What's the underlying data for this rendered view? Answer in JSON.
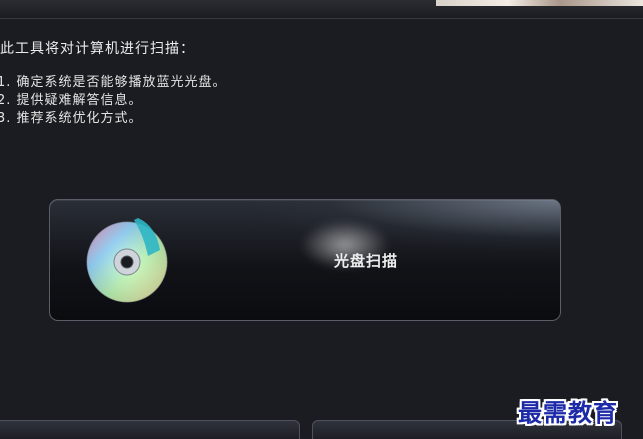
{
  "intro_text": "此工具将对计算机进行扫描：",
  "items": [
    {
      "num": "1.",
      "text": "确定系统是否能够播放蓝光光盘。"
    },
    {
      "num": "2.",
      "text": "提供疑难解答信息。"
    },
    {
      "num": "3.",
      "text": "推荐系统优化方式。"
    }
  ],
  "scan_button": {
    "label": "光盘扫描",
    "icon": "disc-icon"
  },
  "watermark": "最需教育",
  "colors": {
    "background": "#1b1c21",
    "text": "#e6e6e6",
    "watermark": "#1c2aa8"
  }
}
